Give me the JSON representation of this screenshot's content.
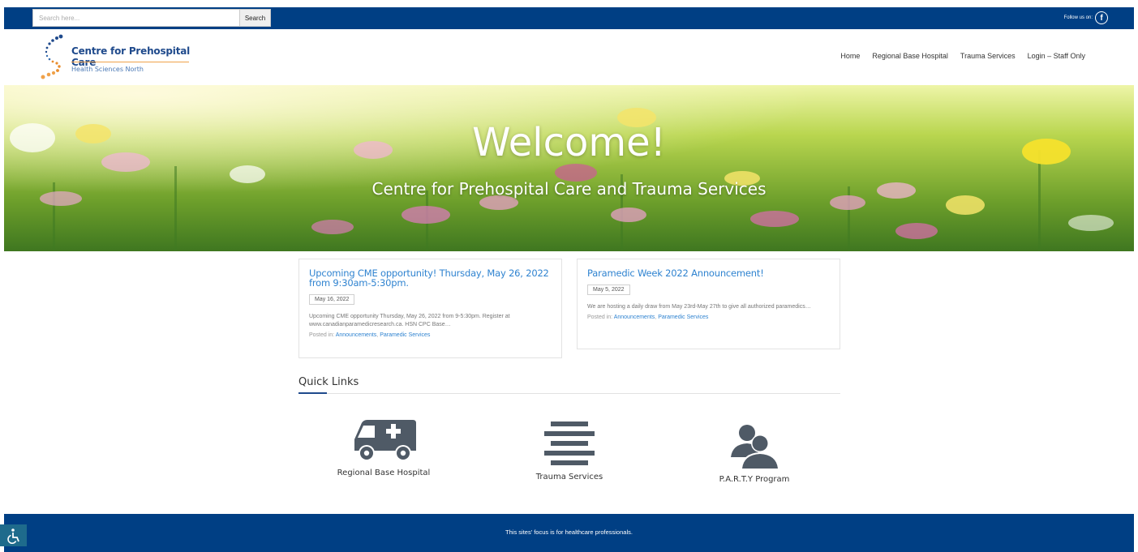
{
  "topbar": {
    "search_placeholder": "Search here...",
    "search_button": "Search",
    "follow_text": "Follow us on:",
    "facebook_glyph": "f"
  },
  "header": {
    "logo_title": "Centre for Prehospital Care",
    "logo_subtitle": "Health Sciences North",
    "nav": [
      "Home",
      "Regional Base Hospital",
      "Trauma Services",
      "Login – Staff Only"
    ]
  },
  "hero": {
    "title": "Welcome!",
    "subtitle": "Centre for Prehospital Care and Trauma Services"
  },
  "posts": [
    {
      "title": "Upcoming CME opportunity! Thursday, May 26, 2022 from 9:30am-5:30pm.",
      "date": "May 16, 2022",
      "excerpt": "Upcoming CME opportunity Thursday, May 26, 2022 from 9-5:30pm. Register at www.canadianparamedicresearch.ca. HSN CPC Base…",
      "posted_in_label": "Posted in:",
      "categories": [
        "Announcements",
        "Paramedic Services"
      ],
      "separator": ", "
    },
    {
      "title": "Paramedic Week 2022 Announcement!",
      "date": "May 5, 2022",
      "excerpt": "We are hosting a daily draw from May 23rd-May 27th to give all authorized paramedics…",
      "posted_in_label": "Posted in:",
      "categories": [
        "Announcements",
        "Paramedic Services"
      ],
      "separator": ", "
    }
  ],
  "quick_links": {
    "title": "Quick Links",
    "items": [
      {
        "label": "Regional Base Hospital",
        "icon": "ambulance-icon"
      },
      {
        "label": "Trauma Services",
        "icon": "list-bars-icon"
      },
      {
        "label": "P.A.R.T.Y Program",
        "icon": "people-icon"
      }
    ]
  },
  "footer": {
    "text": "This sites' focus is for healthcare professionals."
  },
  "colors": {
    "brand_blue": "#003f84",
    "link_blue": "#2f83d0",
    "icon_gray": "#4f5a66"
  }
}
